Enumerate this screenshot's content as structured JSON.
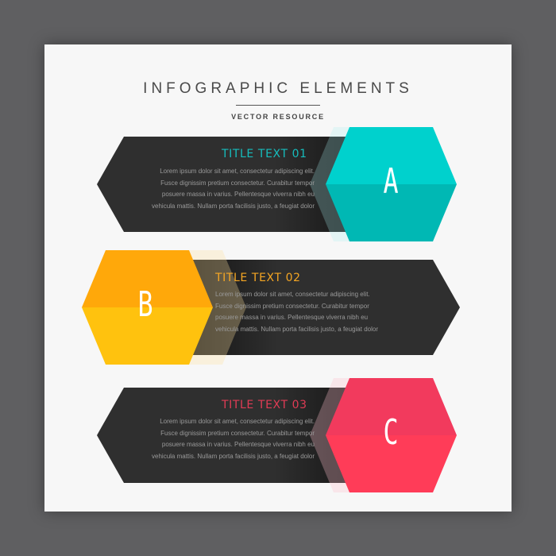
{
  "header": {
    "title": "INFOGRAPHIC ELEMENTS",
    "subtitle": "VECTOR RESOURCE"
  },
  "colors": {
    "background": "#5f5f61",
    "card": "#f7f7f7",
    "banner": "#2f2f2f",
    "a_accent": "#00d1cd",
    "b_accent": "#ffa80a",
    "c_accent": "#f23a5d"
  },
  "items": [
    {
      "letter": "A",
      "title": "TITLE TEXT 01",
      "body": [
        "Lorem ipsum dolor sit amet, consectetur adipiscing elit.",
        "Fusce dignissim pretium consectetur. Curabitur tempor",
        "posuere massa in varius. Pellentesque viverra nibh eu",
        "vehicula mattis. Nullam porta facilisis justo, a feugiat dolor"
      ]
    },
    {
      "letter": "B",
      "title": "TITLE TEXT 02",
      "body": [
        "Lorem ipsum dolor sit amet, consectetur adipiscing elit.",
        "Fusce dignissim pretium consectetur. Curabitur tempor",
        "posuere massa in varius. Pellentesque viverra nibh eu",
        "vehicula mattis. Nullam porta facilisis justo, a feugiat dolor"
      ]
    },
    {
      "letter": "C",
      "title": "TITLE TEXT 03",
      "body": [
        "Lorem ipsum dolor sit amet, consectetur adipiscing elit.",
        "Fusce dignissim pretium consectetur. Curabitur tempor",
        "posuere massa in varius. Pellentesque viverra nibh eu",
        "vehicula mattis. Nullam porta facilisis justo, a feugiat dolor"
      ]
    }
  ]
}
